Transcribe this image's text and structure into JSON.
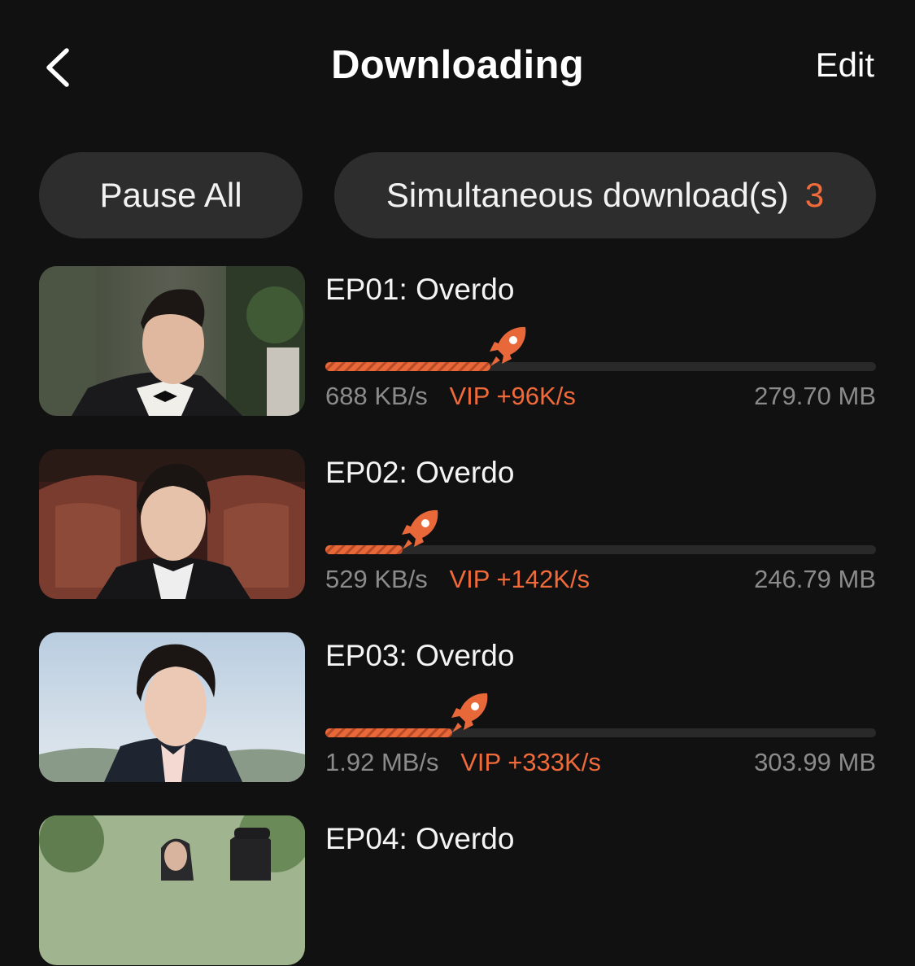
{
  "header": {
    "title": "Downloading",
    "edit_label": "Edit"
  },
  "controls": {
    "pause_all_label": "Pause All",
    "simultaneous_label": "Simultaneous download(s)",
    "simultaneous_count": "3"
  },
  "colors": {
    "background": "#121112",
    "accent": "#f06a3a",
    "pill": "#2e2d2e",
    "muted_text": "#8c8b8c"
  },
  "downloads": [
    {
      "title": "EP01: Overdo",
      "speed": "688 KB/s",
      "vip_boost": "VIP +96K/s",
      "size": "279.70 MB",
      "progress": 0.3
    },
    {
      "title": "EP02: Overdo",
      "speed": "529 KB/s",
      "vip_boost": "VIP +142K/s",
      "size": "246.79 MB",
      "progress": 0.14
    },
    {
      "title": "EP03: Overdo",
      "speed": "1.92 MB/s",
      "vip_boost": "VIP +333K/s",
      "size": "303.99 MB",
      "progress": 0.23
    },
    {
      "title": "EP04: Overdo"
    }
  ]
}
